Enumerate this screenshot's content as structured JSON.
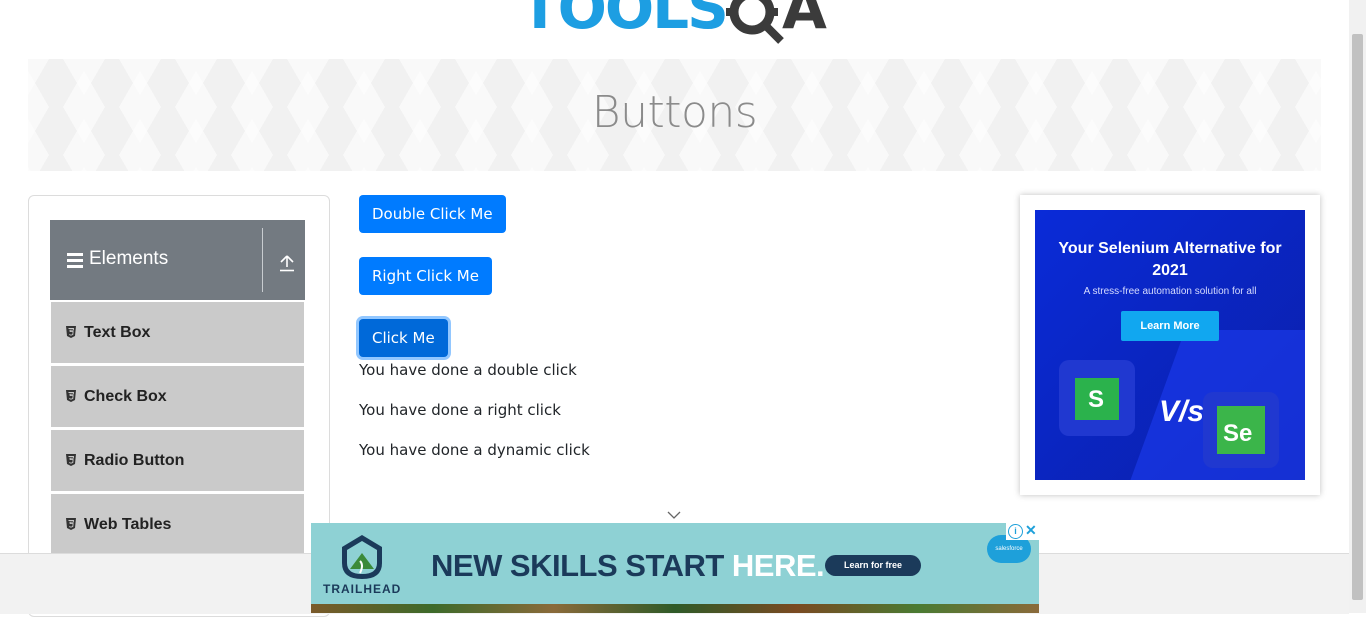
{
  "logo": {
    "text": "TOOLS",
    "suffix": "A"
  },
  "page_title": "Buttons",
  "sidebar": {
    "group_title": "Elements",
    "items": [
      {
        "label": "Text Box"
      },
      {
        "label": "Check Box"
      },
      {
        "label": "Radio Button"
      },
      {
        "label": "Web Tables"
      }
    ]
  },
  "buttons": {
    "double_click": "Double Click Me",
    "right_click": "Right Click Me",
    "click": "Click Me"
  },
  "messages": {
    "double": "You have done a double click",
    "right": "You have done a right click",
    "dynamic": "You have done a dynamic click"
  },
  "side_ad": {
    "headline": "Your Selenium Alternative for 2021",
    "subline": "A stress-free automation solution for all",
    "cta": "Learn More",
    "vs": "V/s",
    "left_logo_letter": "S",
    "right_logo_text": "Se"
  },
  "bottom_ad": {
    "brand": "TRAILHEAD",
    "headline_dark": "NEW SKILLS START ",
    "headline_light": "HERE.",
    "cta": "Learn for free",
    "partner": "salesforce"
  },
  "colors": {
    "primary": "#007bff",
    "sidebar_header": "#737a81",
    "sidebar_item": "#cacaca",
    "ad_blue": "#0a2bd8",
    "teal_ad": "#8ed1d4"
  }
}
